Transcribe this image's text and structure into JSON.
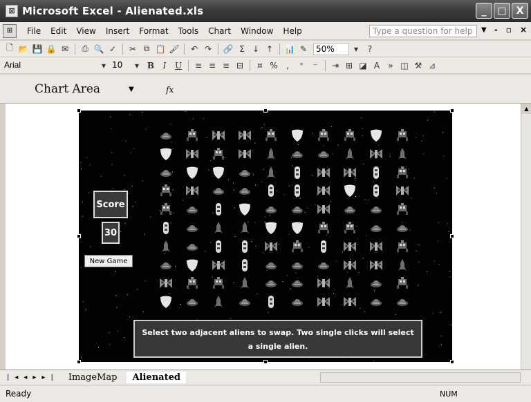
{
  "window": {
    "title": "Microsoft Excel - Alienated.xls",
    "minimize": "_",
    "maximize": "□",
    "close": "X"
  },
  "menu": {
    "items": [
      "File",
      "Edit",
      "View",
      "Insert",
      "Format",
      "Tools",
      "Chart",
      "Window",
      "Help"
    ],
    "help_placeholder": "Type a question for help"
  },
  "toolbar": {
    "zoom": "50%",
    "font": "Arial",
    "size": "10",
    "bold": "B",
    "italic": "I",
    "underline": "U"
  },
  "formula_bar": {
    "name_box": "Chart Area",
    "fx": "fx"
  },
  "game": {
    "score_label": "Score",
    "score_value": "30",
    "new_game_label": "New Game",
    "instructions": "Select two adjacent aliens to swap. Two single clicks will select a single alien.",
    "grid_rows": [
      [
        "ufo",
        "robot",
        "moth",
        "moth",
        "robot",
        "shield",
        "robot",
        "robot",
        "shield",
        "robot"
      ],
      [
        "shield",
        "moth",
        "robot",
        "moth",
        "rocket",
        "ufo",
        "ufo",
        "rocket",
        "moth",
        "rocket"
      ],
      [
        "ufo",
        "shield",
        "shield",
        "ufo",
        "rocket",
        "pod",
        "moth",
        "moth",
        "pod",
        "robot"
      ],
      [
        "robot",
        "moth",
        "ufo",
        "ufo",
        "pod",
        "pod",
        "moth",
        "shield",
        "pod",
        "moth"
      ],
      [
        "robot",
        "ufo",
        "pod",
        "shield",
        "ufo",
        "ufo",
        "moth",
        "ufo",
        "ufo",
        "robot"
      ],
      [
        "pod",
        "ufo",
        "rocket",
        "rocket",
        "shield",
        "shield",
        "robot",
        "robot",
        "ufo",
        "ufo"
      ],
      [
        "rocket",
        "ufo",
        "pod",
        "pod",
        "moth",
        "robot",
        "pod",
        "moth",
        "moth",
        "robot"
      ],
      [
        "ufo",
        "shield",
        "moth",
        "pod",
        "ufo",
        "ufo",
        "ufo",
        "moth",
        "moth",
        "rocket"
      ],
      [
        "moth",
        "robot",
        "robot",
        "rocket",
        "ufo",
        "ufo",
        "moth",
        "rocket",
        "ufo",
        "robot"
      ],
      [
        "shield",
        "ufo",
        "rocket",
        "ufo",
        "pod",
        "ufo",
        "moth",
        "moth",
        "ufo",
        "ufo"
      ]
    ]
  },
  "tabs": {
    "items": [
      "ImageMap",
      "Alienated"
    ],
    "active": "Alienated"
  },
  "status": {
    "left": "Ready",
    "num": "NUM"
  }
}
